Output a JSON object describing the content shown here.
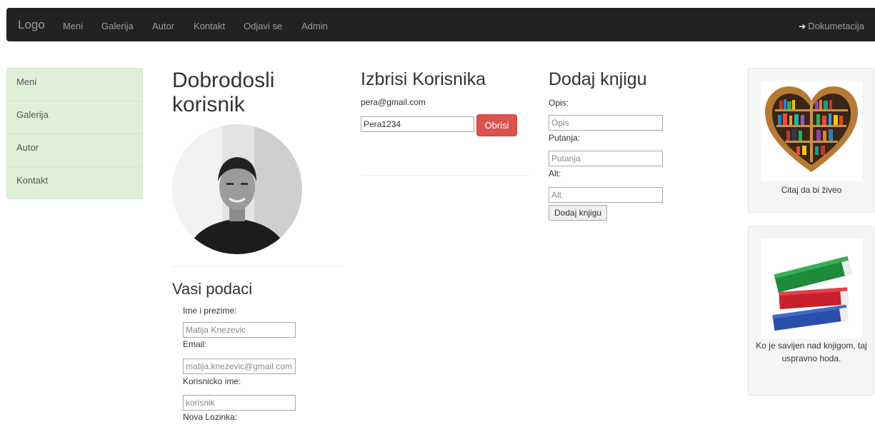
{
  "navbar": {
    "brand": "Logo",
    "links": [
      "Meni",
      "Galerija",
      "Autor",
      "Kontakt",
      "Odjavi se",
      "Admin"
    ],
    "doc_icon": "sign-in-icon",
    "doc_label": "Dokumetacija"
  },
  "sidebar": {
    "items": [
      "Meni",
      "Galerija",
      "Autor",
      "Kontakt"
    ]
  },
  "profile": {
    "welcome": "Dobrodosli korisnik",
    "section_title": "Vasi podaci",
    "fields": [
      {
        "label": "Ime i prezime:",
        "placeholder": "Matija Knezevic"
      },
      {
        "label": "Email:",
        "placeholder": "matija.knezevic@gmail.com"
      },
      {
        "label": "Korisnicko ime:",
        "placeholder": "korisnik"
      },
      {
        "label": "Nova Lozinka:"
      }
    ]
  },
  "delete_user": {
    "title": "Izbrisi Korisnika",
    "email": "pera@gmail.com",
    "input_value": "Pera1234",
    "button": "Obrisi"
  },
  "add_book": {
    "title": "Dodaj knjigu",
    "fields": [
      {
        "label": "Opis:",
        "placeholder": "Opis"
      },
      {
        "label": "Putanja:",
        "placeholder": "Putanja"
      },
      {
        "label": "Alt:",
        "placeholder": "Alt"
      }
    ],
    "button": "Dodaj knjigu"
  },
  "side_cards": [
    {
      "image": "heart-bookshelf-image",
      "caption": "Citaj da bi živeo"
    },
    {
      "image": "book-stack-image",
      "caption": "Ko je savijen nad knjigom, taj uspravno hoda."
    }
  ],
  "colors": {
    "navbar_bg": "#222222",
    "sidebar_bg": "#dff0d8",
    "danger": "#d9534f"
  }
}
